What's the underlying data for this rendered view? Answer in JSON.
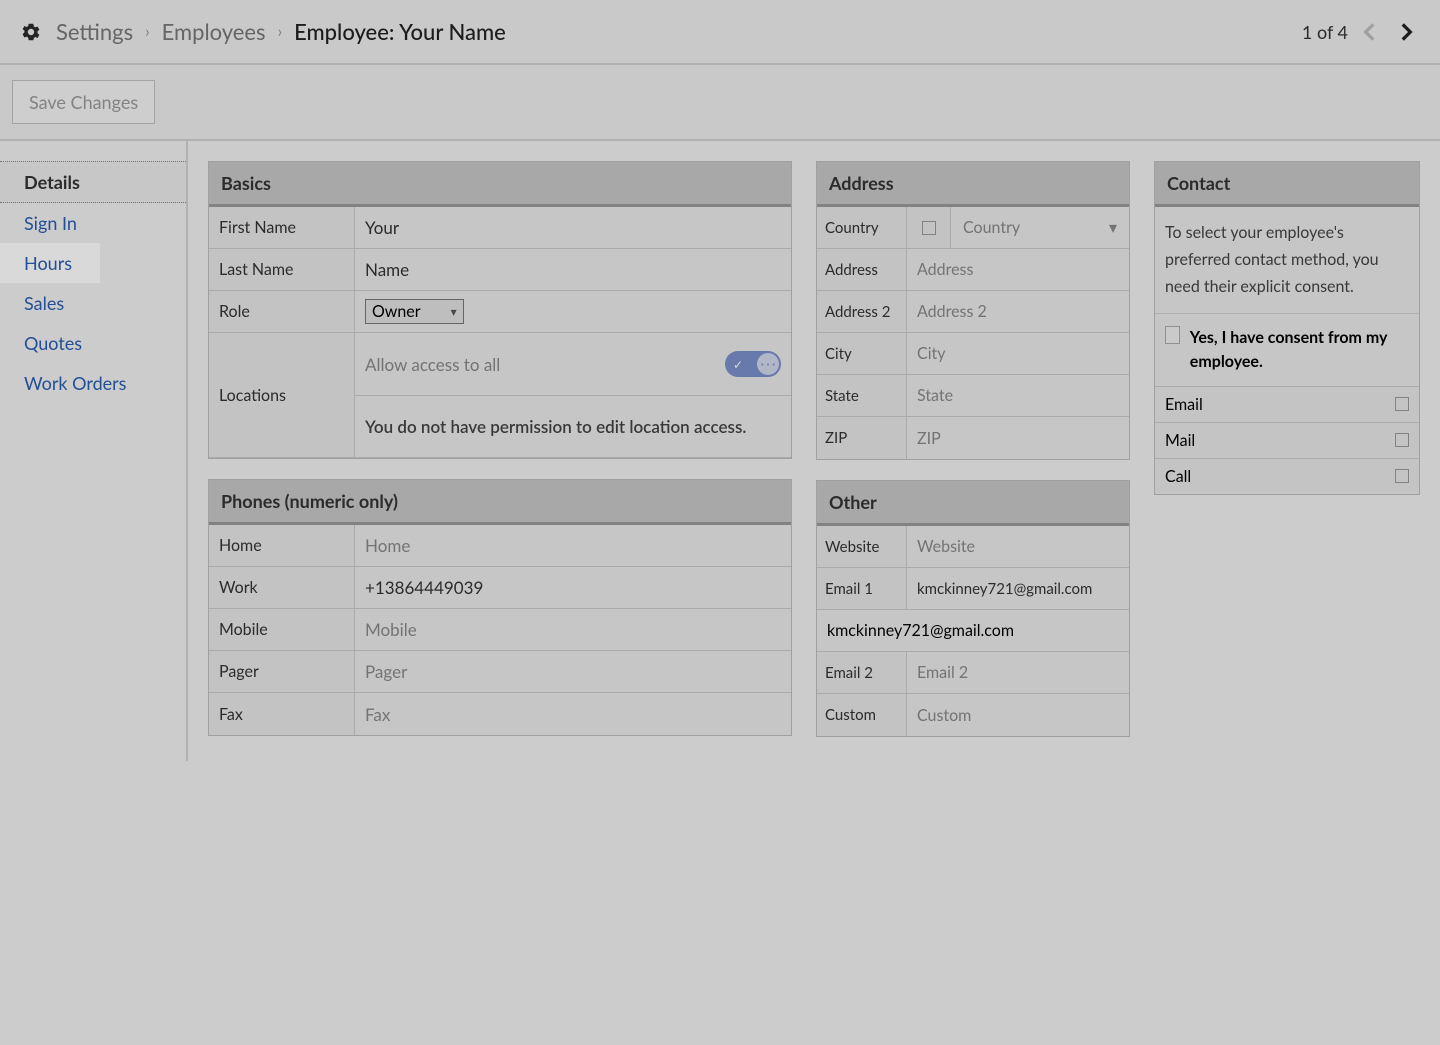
{
  "breadcrumb": {
    "settings": "Settings",
    "employees": "Employees",
    "current": "Employee: Your Name"
  },
  "pager": {
    "text": "1 of 4"
  },
  "save": {
    "label": "Save Changes"
  },
  "sidebar": {
    "items": [
      {
        "label": "Details"
      },
      {
        "label": "Sign In"
      },
      {
        "label": "Hours"
      },
      {
        "label": "Sales"
      },
      {
        "label": "Quotes"
      },
      {
        "label": "Work Orders"
      }
    ]
  },
  "basics": {
    "header": "Basics",
    "first_name_label": "First Name",
    "first_name": "Your",
    "last_name_label": "Last Name",
    "last_name": "Name",
    "role_label": "Role",
    "role": "Owner",
    "locations_label": "Locations",
    "allow_access": "Allow access to all",
    "no_permission": "You do not have permission to edit location access."
  },
  "phones": {
    "header": "Phones (numeric only)",
    "home_label": "Home",
    "home_placeholder": "Home",
    "home_value": "",
    "work_label": "Work",
    "work_value": "+13864449039",
    "mobile_label": "Mobile",
    "mobile_placeholder": "Mobile",
    "mobile_value": "",
    "pager_label": "Pager",
    "pager_placeholder": "Pager",
    "pager_value": "",
    "fax_label": "Fax",
    "fax_placeholder": "Fax",
    "fax_value": ""
  },
  "address": {
    "header": "Address",
    "country_label": "Country",
    "country_placeholder": "Country",
    "address_label": "Address",
    "address_placeholder": "Address",
    "address2_label": "Address 2",
    "address2_placeholder": "Address 2",
    "city_label": "City",
    "city_placeholder": "City",
    "state_label": "State",
    "state_placeholder": "State",
    "zip_label": "ZIP",
    "zip_placeholder": "ZIP"
  },
  "other": {
    "header": "Other",
    "website_label": "Website",
    "website_placeholder": "Website",
    "email1_label": "Email 1",
    "email1_value": "kmckinney721@gmail.com",
    "email1_link": "kmckinney721@gmail.com",
    "email2_label": "Email 2",
    "email2_placeholder": "Email 2",
    "custom_label": "Custom",
    "custom_placeholder": "Custom"
  },
  "contact": {
    "header": "Contact",
    "body": "To select your employee's preferred contact method, you need their explicit consent.",
    "consent": "Yes, I have consent from my employee.",
    "methods": {
      "email": "Email",
      "mail": "Mail",
      "call": "Call"
    }
  }
}
